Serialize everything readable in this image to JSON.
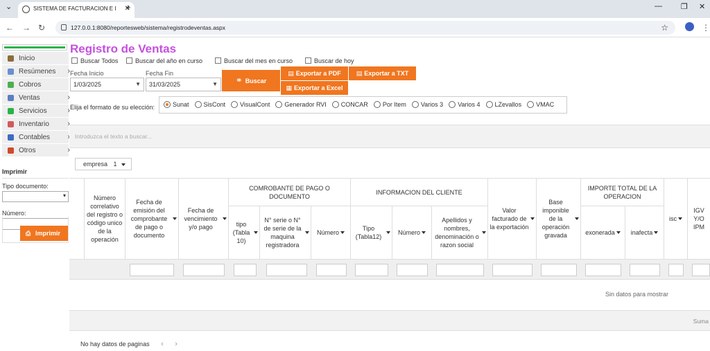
{
  "browser": {
    "tab_title": "SISTEMA DE FACTURACION E I",
    "url": "127.0.0.1:8080/reportesweb/sistema/registrodeventas.aspx"
  },
  "sidebar": {
    "items": [
      {
        "label": "Inicio",
        "icon": "home-icon",
        "color": "#8a6d3b",
        "chevron": false
      },
      {
        "label": "Resúmenes",
        "icon": "chart-icon",
        "color": "#6a8fd0",
        "chevron": true
      },
      {
        "label": "Cobros",
        "icon": "money-icon",
        "color": "#4caf50",
        "chevron": false
      },
      {
        "label": "Ventas",
        "icon": "cart-icon",
        "color": "#5b7fc0",
        "chevron": true
      },
      {
        "label": "Servicios",
        "icon": "services-icon",
        "color": "#2ab34a",
        "chevron": true
      },
      {
        "label": "Inventario",
        "icon": "inventory-icon",
        "color": "#d05b5b",
        "chevron": true
      },
      {
        "label": "Contables",
        "icon": "book-icon",
        "color": "#3d6bc4",
        "chevron": true
      },
      {
        "label": "Otros",
        "icon": "other-icon",
        "color": "#d04a2a",
        "chevron": true
      }
    ]
  },
  "print_panel": {
    "title": "Imprimir",
    "doc_type_label": "Tipo documento:",
    "doc_type_value": "",
    "number_label": "Número:",
    "number_value": "",
    "button": "Imprimir"
  },
  "main": {
    "title": "Registro de Ventas",
    "checks": [
      "Buscar Todos",
      "Buscar del año en curso",
      "Buscar del mes en curso",
      "Buscar de hoy"
    ],
    "start_label": "Fecha Inicio",
    "start_value": "1/03/2025",
    "end_label": "Fecha Fin",
    "end_value": "31/03/2025",
    "search_button": "Buscar",
    "pdf_button": "Exportar a PDF",
    "txt_button": "Exportar a TXT",
    "excel_button": "Exportar a Excel",
    "format_label": "Elija el formato de su elección:",
    "formats": [
      "Sunat",
      "SisCont",
      "VisualCont",
      "Generador RVI",
      "CONCAR",
      "Por Item",
      "Varios 3",
      "Varios 4",
      "LZevallos",
      "VMAC"
    ],
    "selected_format": "Sunat",
    "search_placeholder": "Introduzca el texto a buscar...",
    "group_chip": "empresa",
    "group_chip_sort": "1",
    "no_data": "Sin datos para mostrar",
    "summary": "Suma",
    "pager": "No hay datos de paginas"
  },
  "grid": {
    "col_correlativo": "Número correlativo del registro o código unico de la operación",
    "col_fecha_emision": "Fecha de emisión del comprobante de pago o documento",
    "col_fecha_venc": "Fecha de vencimiento y/o pago",
    "group_comprobante": "COMROBANTE DE PAGO O DOCUMENTO",
    "col_tipo": "tipo (Tabla 10)",
    "col_serie": "N° serie o N° de serie de la maquina registradora",
    "col_numero": "Número",
    "group_cliente": "INFORMACION DEL CLIENTE",
    "col_tipo_doc": "Tipo (Tabla12)",
    "col_num_doc": "Número",
    "col_nombre": "Apellidos y nombres, denominación o razon social",
    "col_valor_exp": "Valor facturado de la exportación",
    "col_base": "Base imponible de la operación gravada",
    "group_importe": "IMPORTE TOTAL DE LA OPERACION",
    "col_exonerada": "exonerada",
    "col_inafecta": "inafecta",
    "col_isc": "isc",
    "col_igv": "IGV Y/O IPM"
  }
}
